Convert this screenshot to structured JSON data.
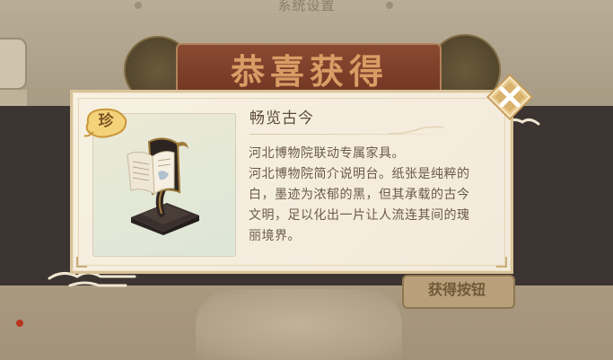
{
  "background": {
    "title": "系统设置",
    "banner": "恭喜获得",
    "bottom_button": "获得按钮"
  },
  "dialog": {
    "rarity": "珍",
    "item_name": "畅览古今",
    "description": [
      "河北博物院联动专属家具。",
      "河北博物院简介说明台。纸张是纯粹的",
      "白，墨迹为浓郁的黑，但其承载的古今",
      "文明，足以化出一片让人流连其间的瑰",
      "丽境界。"
    ],
    "close_icon": "close-x-icon"
  },
  "colors": {
    "panel_bg": "#f4ecdc",
    "panel_border": "#d9c39a",
    "title_text": "#5b4c3c",
    "body_text": "#6b5b49",
    "close_button": "#d9b77c"
  }
}
